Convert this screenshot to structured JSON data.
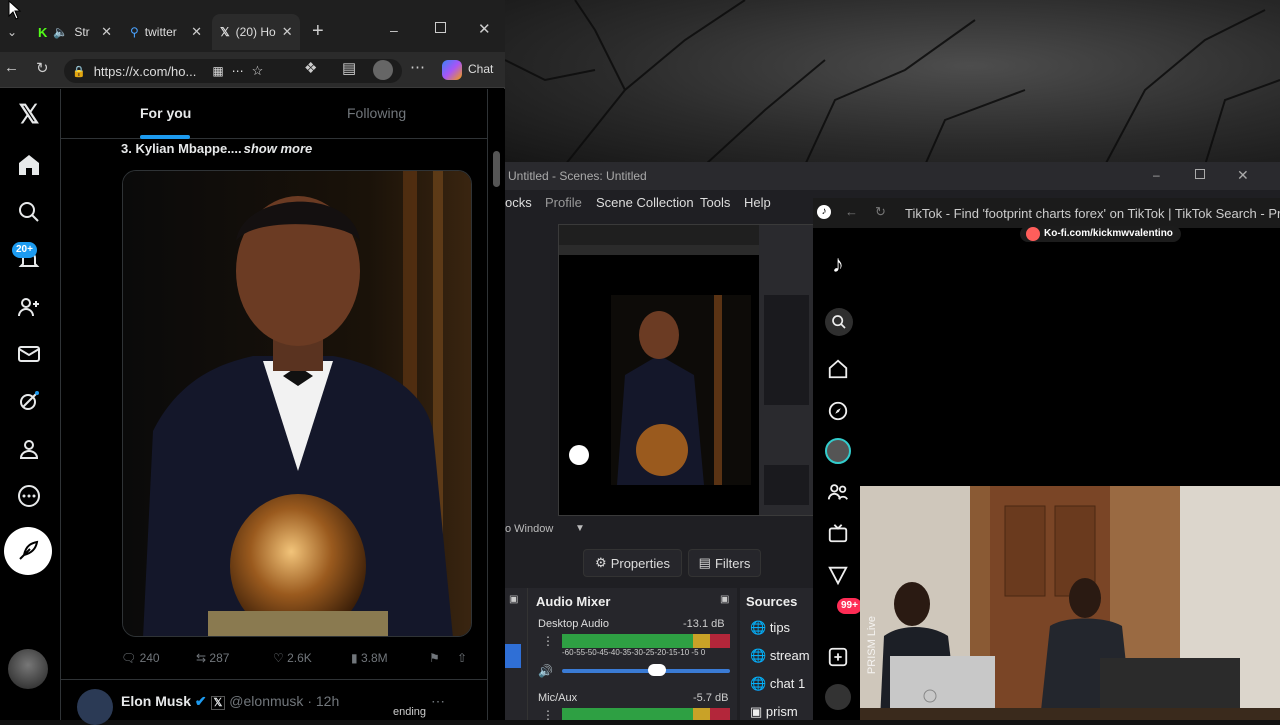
{
  "browser": {
    "tabs": [
      {
        "label": "Str",
        "icon": "kick-icon"
      },
      {
        "label": "twitter",
        "icon": "search-icon"
      },
      {
        "label": "(20) Ho",
        "icon": "x-logo-icon"
      }
    ],
    "url": "https://x.com/ho...",
    "chat_label": "Chat"
  },
  "x": {
    "tabs": [
      "For you",
      "Following"
    ],
    "notification_badge": "20+",
    "tweet_text": "3. Kylian Mbappe....",
    "show_more": "show more",
    "stats": {
      "replies": "240",
      "reposts": "287",
      "likes": "2.6K",
      "views": "3.8M"
    },
    "next_author": "Elon Musk",
    "next_handle": "@elonmusk · 12h"
  },
  "obs": {
    "window_title": "Untitled - Scenes: Untitled",
    "menu": [
      "ocks",
      "Profile",
      "Scene Collection",
      "Tools",
      "Help"
    ],
    "window_label": "o Window",
    "properties_label": "Properties",
    "filters_label": "Filters",
    "audio_mixer_title": "Audio Mixer",
    "sources_title": "Sources",
    "desktop_audio_label": "Desktop Audio",
    "desktop_audio_db": "-13.1 dB",
    "meter_scale": "-60-55-50-45-40-35-30-25-20-15-10 -5  0",
    "mic_label": "Mic/Aux",
    "mic_db": "-5.7 dB",
    "sources": [
      "tips",
      "stream",
      "chat 1",
      "prism"
    ],
    "bottom_label": "ending"
  },
  "tiktok": {
    "window_title": "TikTok - Find 'footprint charts forex' on TikTok | TikTok Search - Pr",
    "kofi_label": "Ko-fi.com/kickmwvalentino",
    "badge_99": "99+",
    "prism_label": "PRISM Live"
  },
  "colors": {
    "x_blue": "#1d9bf0",
    "x_bg": "#000000",
    "obs_bg": "#1f1f23",
    "meter_green": "#2ea043",
    "meter_red": "#b3263a"
  }
}
